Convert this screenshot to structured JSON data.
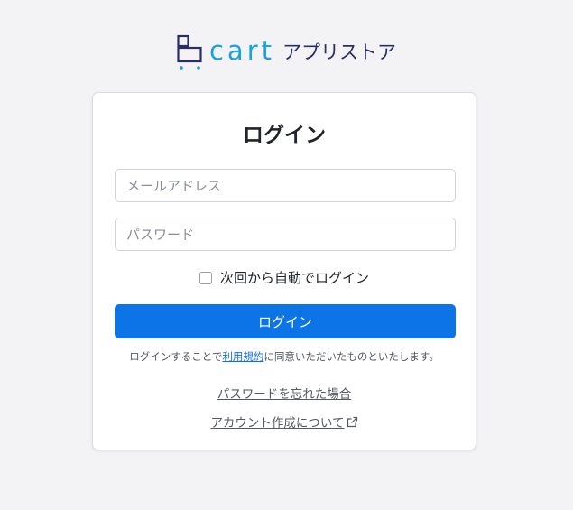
{
  "brand": {
    "wordmark": "cart",
    "suffix": "アプリストア",
    "accent_color": "#1aa1e0",
    "dark_color": "#2b2d6b",
    "logo_icon": "b-cart-logo-icon"
  },
  "login": {
    "title": "ログイン",
    "email_placeholder": "メールアドレス",
    "password_placeholder": "パスワード",
    "remember_label": "次回から自動でログイン",
    "submit_label": "ログイン",
    "submit_color": "#0d74e7",
    "terms_prefix": "ログインすることで",
    "terms_link": "利用規約",
    "terms_suffix": "に同意いただいたものといたします。",
    "forgot_password": "パスワードを忘れた場合",
    "account_link": "アカウント作成について",
    "account_link_icon": "external-link-icon"
  }
}
